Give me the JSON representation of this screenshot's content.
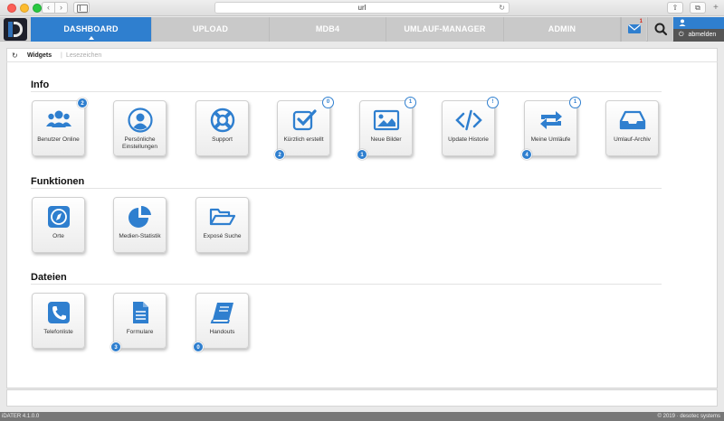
{
  "browser": {
    "url": "url",
    "back": "‹",
    "forward": "›",
    "reload": "↻",
    "share": "⇧",
    "tabs": "⧉",
    "new_tab": "+"
  },
  "nav": {
    "tabs": [
      {
        "label": "DASHBOARD",
        "active": true
      },
      {
        "label": "UPLOAD",
        "active": false
      },
      {
        "label": "MDB4",
        "active": false
      },
      {
        "label": "UMLAUF-MANAGER",
        "active": false
      },
      {
        "label": "ADMIN",
        "active": false
      }
    ],
    "mail_count": "1",
    "logout_label": "abmelden",
    "power_glyph": "⏻"
  },
  "toolbar": {
    "refresh": "↻",
    "widgets_label": "Widgets",
    "separator": "|",
    "lesezeichen_label": "Lesezeichen"
  },
  "sections": {
    "info": {
      "title": "Info",
      "tiles": [
        {
          "label": "Benutzer Online",
          "icon": "users-icon",
          "badge_top": "2"
        },
        {
          "label": "Persönliche Einstellungen",
          "icon": "user-circle-icon"
        },
        {
          "label": "Support",
          "icon": "lifebuoy-icon"
        },
        {
          "label": "Kürzlich erstellt",
          "icon": "checkbox-icon",
          "badge_top": "0",
          "badge_bottom": "2"
        },
        {
          "label": "Neue Bilder",
          "icon": "image-icon",
          "badge_top": "1",
          "badge_bottom": "1"
        },
        {
          "label": "Update Historie",
          "icon": "code-icon",
          "badge_top": "!"
        },
        {
          "label": "Meine Umläufe",
          "icon": "retweet-icon",
          "badge_top": "1",
          "badge_bottom": "4"
        },
        {
          "label": "Umlauf-Archiv",
          "icon": "inbox-icon"
        }
      ]
    },
    "funktionen": {
      "title": "Funktionen",
      "tiles": [
        {
          "label": "Orte",
          "icon": "compass-icon"
        },
        {
          "label": "Medien-Statistik",
          "icon": "pie-chart-icon"
        },
        {
          "label": "Exposé Suche",
          "icon": "folder-open-icon"
        }
      ]
    },
    "dateien": {
      "title": "Dateien",
      "tiles": [
        {
          "label": "Telefonliste",
          "icon": "phone-icon"
        },
        {
          "label": "Formulare",
          "icon": "document-icon",
          "badge_bottom": "3"
        },
        {
          "label": "Handouts",
          "icon": "book-icon",
          "badge_bottom": "0"
        }
      ]
    }
  },
  "footer": {
    "version": "iDATER 4.1.0.0",
    "copyright": "© 2019 · desotec systems"
  },
  "colors": {
    "accent": "#2f7fcf",
    "header_bg": "#c9c9c9",
    "footer_bg": "#777777"
  }
}
